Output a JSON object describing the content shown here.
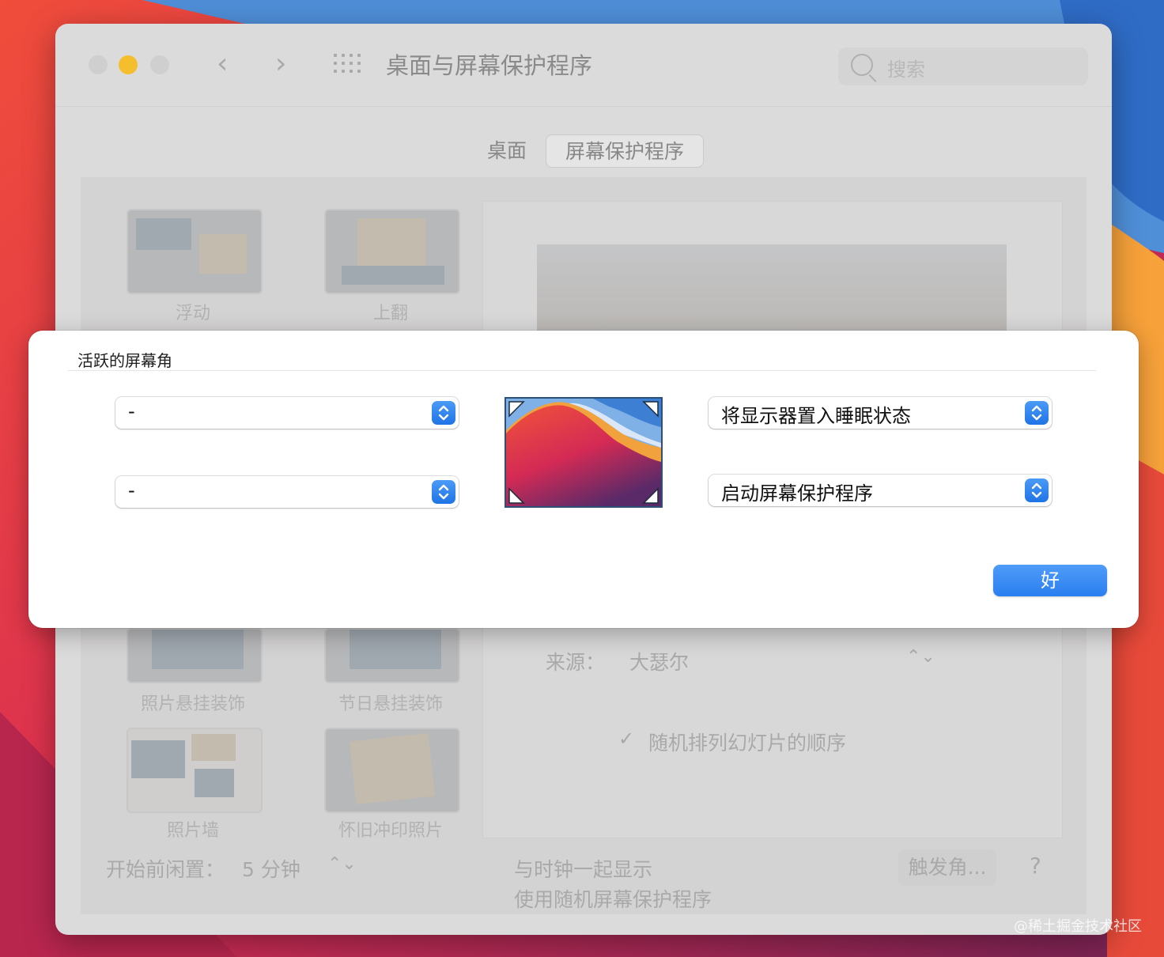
{
  "window": {
    "title": "桌面与屏幕保护程序",
    "search_placeholder": "搜索",
    "back_arrow": "‹",
    "forward_arrow": "›"
  },
  "tabs": [
    {
      "label": "桌面",
      "selected": false
    },
    {
      "label": "屏幕保护程序",
      "selected": true
    }
  ],
  "screensavers": [
    {
      "label": "浮动"
    },
    {
      "label": "上翻"
    },
    {
      "label": "照片悬挂装饰"
    },
    {
      "label": "节日悬挂装饰"
    },
    {
      "label": "照片墙"
    },
    {
      "label": "怀旧冲印照片"
    }
  ],
  "options": {
    "source_label": "来源：",
    "source_value": "大瑟尔",
    "source_arrows": "⌃⌄",
    "shuffle_check": "✓",
    "shuffle_label": "随机排列幻灯片的顺序"
  },
  "footer": {
    "idle_label": "开始前闲置：",
    "idle_value": "5 分钟",
    "idle_arrows": "⌃⌄",
    "show_clock": "与时钟一起显示",
    "use_random": "使用随机屏幕保护程序",
    "hot_corners_button": "触发角...",
    "help_button": "?"
  },
  "dialog": {
    "title": "活跃的屏幕角",
    "top_left": "-",
    "bottom_left": "-",
    "top_right": "将显示器置入睡眠状态",
    "bottom_right": "启动屏幕保护程序",
    "ok_button": "好"
  },
  "watermark": "@稀土掘金技术社区",
  "colors": {
    "accent": "#2a7ef0",
    "traffic_yellow": "#f5be2c"
  }
}
